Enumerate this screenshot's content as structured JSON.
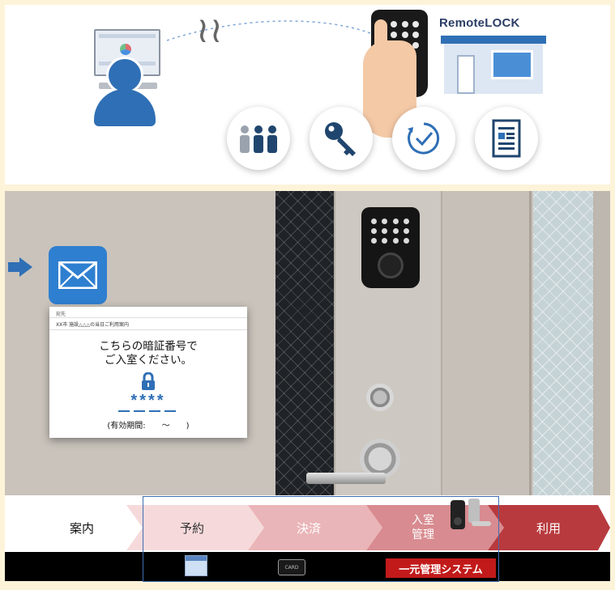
{
  "top_panel": {
    "logo": "RemoteLOCK",
    "icons": [
      "people-icon",
      "key-icon",
      "clock-refresh-icon",
      "document-icon"
    ]
  },
  "photo_panel": {
    "mail_icon": "envelope-icon",
    "notice": {
      "header": "宛先",
      "subject": "XX市 施設△△△の当日ご利用案内",
      "message_line1": "こちらの暗証番号で",
      "message_line2": "ご入室ください。",
      "code": "****",
      "period": "(有効期間:　　～　　)"
    }
  },
  "flow": {
    "steps": [
      {
        "label": "案内"
      },
      {
        "label": "予約"
      },
      {
        "label": "決済"
      },
      {
        "label": "入室\n管理"
      },
      {
        "label": "利用"
      }
    ],
    "card_icon_text": "CARD",
    "system_badge": "一元管理システム"
  },
  "colors": {
    "frame_bg": "#fdf3d9",
    "accent_blue": "#2f6fb5",
    "step_pink_light": "#f6dadb",
    "step_pink_mid": "#eab5b8",
    "step_pink_dark": "#d88b90",
    "step_red": "#b83a3e",
    "badge_red": "#c21a1a"
  }
}
